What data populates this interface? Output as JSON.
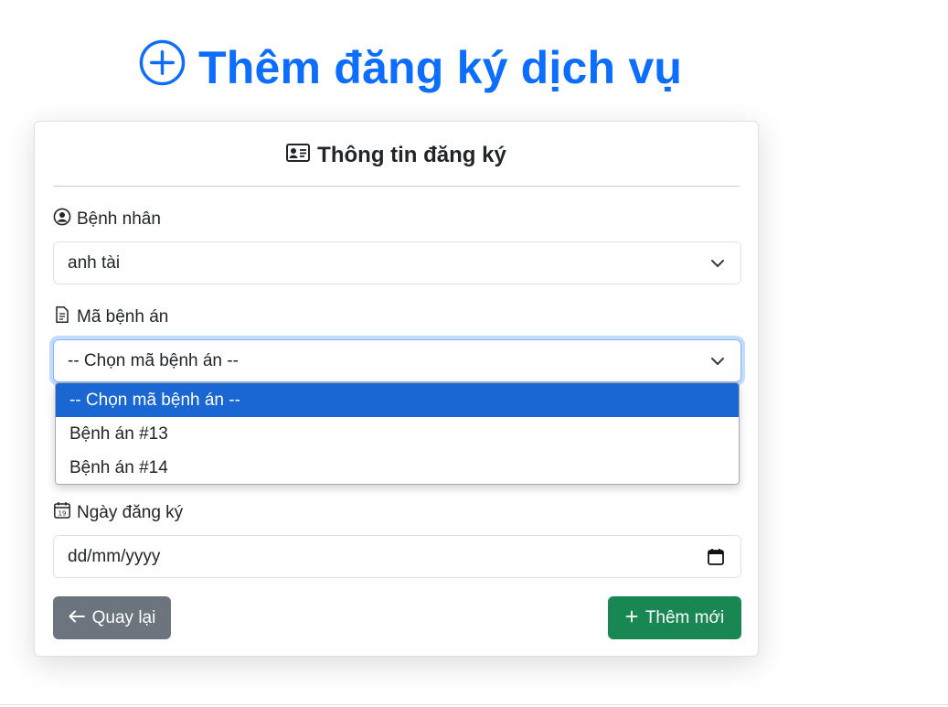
{
  "page": {
    "title": "Thêm đăng ký dịch vụ"
  },
  "card": {
    "title": "Thông tin đăng ký"
  },
  "fields": {
    "patient": {
      "label": "Bệnh nhân",
      "value": "anh tài"
    },
    "record": {
      "label": "Mã bệnh án",
      "value": "-- Chọn mã bệnh án --",
      "options": [
        "-- Chọn mã bệnh án --",
        "Bệnh án #13",
        "Bệnh án #14"
      ]
    },
    "date": {
      "label": "Ngày đăng ký",
      "placeholder": "dd/mm/yyyy"
    }
  },
  "buttons": {
    "back": "Quay lại",
    "add": "Thêm mới"
  },
  "colors": {
    "primary": "#0d6efd",
    "secondary": "#6c757d",
    "success": "#198754",
    "selected_option": "#1a66d2"
  }
}
